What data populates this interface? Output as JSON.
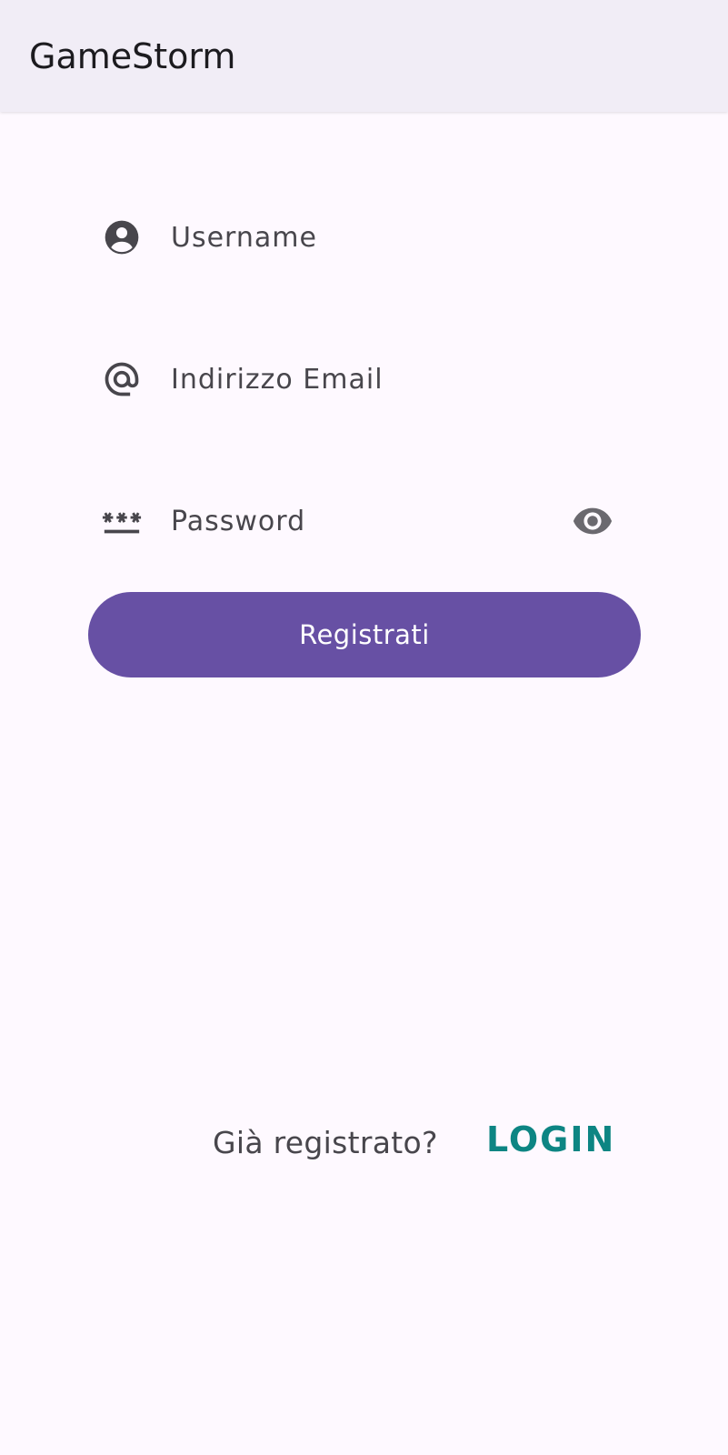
{
  "app_bar": {
    "title": "GameStorm"
  },
  "form": {
    "username": {
      "placeholder": "Username",
      "value": "",
      "icon": "account-circle-icon"
    },
    "email": {
      "placeholder": "Indirizzo Email",
      "value": "",
      "icon": "at-sign-icon"
    },
    "password": {
      "placeholder": "Password",
      "value": "",
      "icon": "password-icon",
      "toggle_icon": "eye-icon"
    },
    "register_label": "Registrati"
  },
  "footer": {
    "already_registered": "Già registrato?",
    "login_label": "LOGIN"
  },
  "colors": {
    "primary": "#6750a4",
    "link": "#0d8583",
    "app_bar_bg": "#f1edf6",
    "background": "#fef9ff",
    "text": "#48464c"
  }
}
